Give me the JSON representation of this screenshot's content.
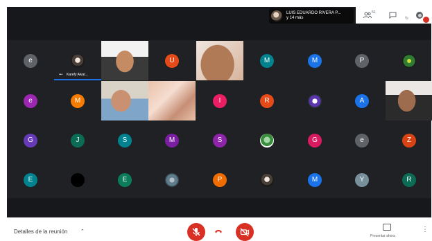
{
  "presenter": {
    "name": "LUIS EDUARDO RIVERA P...",
    "others": "y 14 más"
  },
  "top_icons": {
    "people_count": "51",
    "chat_icon": "chat-icon",
    "activities_icon": "activities-icon"
  },
  "grid": {
    "rows": [
      [
        {
          "type": "avatar",
          "letter": "e",
          "color": "#5f6368"
        },
        {
          "type": "avatar-photo",
          "name": "Karefy Alvar...",
          "speaking": true
        },
        {
          "type": "video",
          "scene": "boy"
        },
        {
          "type": "avatar",
          "letter": "U",
          "color": "#e64a19"
        },
        {
          "type": "video",
          "scene": "closeup"
        },
        {
          "type": "avatar",
          "letter": "M",
          "color": "#00838f"
        },
        {
          "type": "avatar",
          "letter": "M",
          "color": "#1a73e8"
        },
        {
          "type": "avatar",
          "letter": "P",
          "color": "#5f6368"
        },
        {
          "type": "avatar-photo",
          "name": ""
        }
      ],
      [
        {
          "type": "avatar",
          "letter": "e",
          "color": "#9c27b0"
        },
        {
          "type": "avatar",
          "letter": "M",
          "color": "#f57c00"
        },
        {
          "type": "video",
          "scene": "child"
        },
        {
          "type": "video",
          "scene": "blur"
        },
        {
          "type": "avatar",
          "letter": "I",
          "color": "#e91e63"
        },
        {
          "type": "avatar",
          "letter": "R",
          "color": "#e64a19"
        },
        {
          "type": "avatar-photo",
          "name": ""
        },
        {
          "type": "avatar",
          "letter": "A",
          "color": "#1a73e8"
        },
        {
          "type": "video",
          "scene": "man"
        }
      ],
      [
        {
          "type": "avatar",
          "letter": "G",
          "color": "#673ab7"
        },
        {
          "type": "avatar",
          "letter": "J",
          "color": "#0b6b55"
        },
        {
          "type": "avatar",
          "letter": "S",
          "color": "#00838f"
        },
        {
          "type": "avatar",
          "letter": "M",
          "color": "#7b1fa2"
        },
        {
          "type": "avatar",
          "letter": "S",
          "color": "#8e24aa"
        },
        {
          "type": "avatar-photo",
          "name": ""
        },
        {
          "type": "avatar",
          "letter": "G",
          "color": "#d81b60"
        },
        {
          "type": "avatar",
          "letter": "e",
          "color": "#5f6368"
        },
        {
          "type": "avatar",
          "letter": "Z",
          "color": "#d84315"
        }
      ],
      [
        {
          "type": "avatar",
          "letter": "E",
          "color": "#00838f"
        },
        {
          "type": "avatar",
          "letter": "",
          "color": "#000000"
        },
        {
          "type": "avatar",
          "letter": "E",
          "color": "#0b7d5a"
        },
        {
          "type": "avatar-photo",
          "name": ""
        },
        {
          "type": "avatar",
          "letter": "P",
          "color": "#ef6c00"
        },
        {
          "type": "avatar-photo",
          "name": ""
        },
        {
          "type": "avatar",
          "letter": "M",
          "color": "#1a73e8"
        },
        {
          "type": "avatar",
          "letter": "Y",
          "color": "#78909c"
        },
        {
          "type": "avatar",
          "letter": "R",
          "color": "#0b6b55"
        }
      ]
    ]
  },
  "bottom": {
    "meeting_details": "Detalles de la reunión",
    "present_now": "Presentar ahora"
  },
  "colors": {
    "stage": "#202124",
    "danger": "#d93025",
    "accent": "#1a73e8"
  }
}
